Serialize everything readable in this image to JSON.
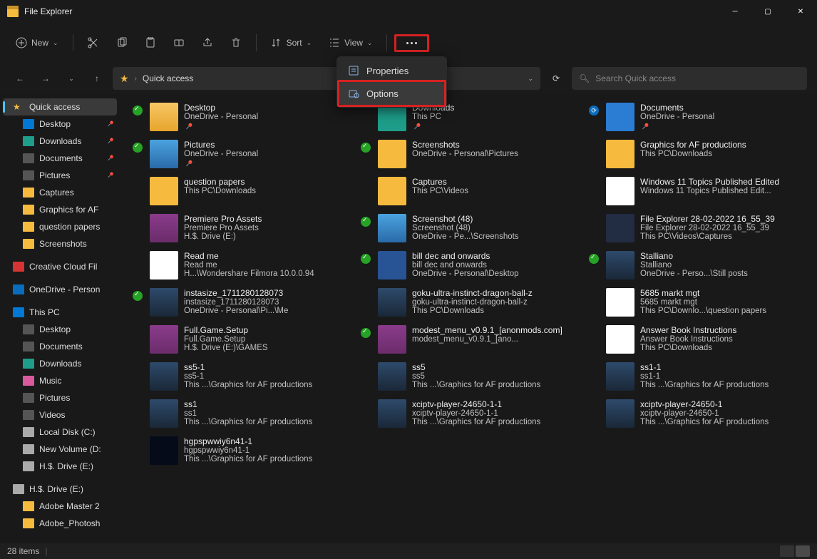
{
  "titlebar": {
    "title": "File Explorer"
  },
  "toolbar": {
    "new": "New",
    "sort": "Sort",
    "view": "View"
  },
  "dropdown": {
    "properties": "Properties",
    "options": "Options"
  },
  "address": {
    "location": "Quick access",
    "chevron": "›"
  },
  "search": {
    "placeholder": "Search Quick access"
  },
  "sidebar": {
    "quick_access": "Quick access",
    "desktop": "Desktop",
    "downloads": "Downloads",
    "documents": "Documents",
    "pictures": "Pictures",
    "captures": "Captures",
    "graphics": "Graphics for AF",
    "qpapers": "question papers",
    "screenshots": "Screenshots",
    "ccf": "Creative Cloud Fil",
    "onedrive": "OneDrive - Person",
    "thispc": "This PC",
    "tpc_desktop": "Desktop",
    "tpc_documents": "Documents",
    "tpc_downloads": "Downloads",
    "tpc_music": "Music",
    "tpc_pictures": "Pictures",
    "tpc_videos": "Videos",
    "tpc_c": "Local Disk (C:)",
    "tpc_d": "New Volume (D:",
    "tpc_e": "H.$. Drive (E:)",
    "usb": "H.$. Drive (E:)",
    "usb1": "Adobe Master 2",
    "usb2": "Adobe_Photosh"
  },
  "files": [
    {
      "sync": "green",
      "th": "th-folder-lg",
      "name": "Desktop",
      "sub": "OneDrive - Personal",
      "pin": true
    },
    {
      "sync": "",
      "th": "th-down",
      "name": "Downloads",
      "sub": "This PC",
      "pin": true
    },
    {
      "sync": "blue",
      "th": "th-docs",
      "name": "Documents",
      "sub": "OneDrive - Personal",
      "pin": true
    },
    {
      "sync": "green",
      "th": "th-pic",
      "name": "Pictures",
      "sub": "OneDrive - Personal",
      "pin": true
    },
    {
      "sync": "green",
      "th": "th-folder",
      "name": "Screenshots",
      "sub": "OneDrive - Personal\\Pictures"
    },
    {
      "sync": "",
      "th": "th-folder",
      "name": "Graphics for AF productions",
      "sub": "This PC\\Downloads"
    },
    {
      "sync": "",
      "th": "th-folder",
      "name": "question papers",
      "sub": "This PC\\Downloads"
    },
    {
      "sync": "",
      "th": "th-folder",
      "name": "Captures",
      "sub": "This PC\\Videos"
    },
    {
      "sync": "",
      "th": "th-txt",
      "name": "Windows 11 Topics Published Edited",
      "sub": "Windows 11 Topics Published Edit..."
    },
    {
      "sync": "",
      "th": "th-rar",
      "name": "Premiere Pro Assets",
      "sub": "Premiere Pro Assets",
      "sub2": "H.$. Drive (E:)"
    },
    {
      "sync": "green",
      "th": "th-pic",
      "name": "Screenshot (48)",
      "sub": "Screenshot (48)",
      "sub2": "OneDrive - Pe...\\Screenshots"
    },
    {
      "sync": "",
      "th": "th-screenshot",
      "name": "File Explorer 28-02-2022 16_55_39",
      "sub": "File Explorer 28-02-2022 16_55_39",
      "sub2": "This PC\\Videos\\Captures"
    },
    {
      "sync": "",
      "th": "th-txt",
      "name": "Read me",
      "sub": "Read me",
      "sub2": "H...\\Wondershare Filmora 10.0.0.94"
    },
    {
      "sync": "green",
      "th": "th-word",
      "name": "bill dec and onwards",
      "sub": "bill dec and onwards",
      "sub2": "OneDrive - Personal\\Desktop"
    },
    {
      "sync": "green",
      "th": "th-img",
      "name": "Stalliano",
      "sub": "Stalliano",
      "sub2": "OneDrive - Perso...\\Still posts"
    },
    {
      "sync": "green",
      "th": "th-img",
      "name": "instasize_1711280128073",
      "sub": "instasize_1711280128073",
      "sub2": "OneDrive - Personal\\Pi...\\Me"
    },
    {
      "sync": "",
      "th": "th-img",
      "name": "goku-ultra-instinct-dragon-ball-z",
      "sub": "goku-ultra-instinct-dragon-ball-z",
      "sub2": "This PC\\Downloads"
    },
    {
      "sync": "",
      "th": "th-pdf",
      "name": "5685 markt mgt",
      "sub": "5685 markt mgt",
      "sub2": "This PC\\Downlo...\\question papers"
    },
    {
      "sync": "",
      "th": "th-rar",
      "name": "Full.Game.Setup",
      "sub": "Full.Game.Setup",
      "sub2": "H.$. Drive (E:)\\GAMES"
    },
    {
      "sync": "green",
      "th": "th-rar",
      "name": "modest_menu_v0.9.1_[anonmods.com]",
      "sub": "modest_menu_v0.9.1_[ano..."
    },
    {
      "sync": "",
      "th": "th-pdf",
      "name": "Answer Book Instructions",
      "sub": "Answer Book Instructions",
      "sub2": "This PC\\Downloads"
    },
    {
      "sync": "",
      "th": "th-img",
      "name": "ss5-1",
      "sub": "ss5-1",
      "sub2": "This ...\\Graphics for AF productions"
    },
    {
      "sync": "",
      "th": "th-img",
      "name": "ss5",
      "sub": "ss5",
      "sub2": "This ...\\Graphics for AF productions"
    },
    {
      "sync": "",
      "th": "th-img",
      "name": "ss1-1",
      "sub": "ss1-1",
      "sub2": "This ...\\Graphics for AF productions"
    },
    {
      "sync": "",
      "th": "th-img",
      "name": "ss1",
      "sub": "ss1",
      "sub2": "This ...\\Graphics for AF productions"
    },
    {
      "sync": "",
      "th": "th-img",
      "name": "xciptv-player-24650-1-1",
      "sub": "xciptv-player-24650-1-1",
      "sub2": "This ...\\Graphics for AF productions"
    },
    {
      "sync": "",
      "th": "th-img",
      "name": "xciptv-player-24650-1",
      "sub": "xciptv-player-24650-1",
      "sub2": "This ...\\Graphics for AF productions"
    },
    {
      "sync": "",
      "th": "th-vid",
      "name": "hgpspwwiy6n41-1",
      "sub": "hgpspwwiy6n41-1",
      "sub2": "This ...\\Graphics for AF productions"
    }
  ],
  "status": {
    "count": "28 items"
  }
}
